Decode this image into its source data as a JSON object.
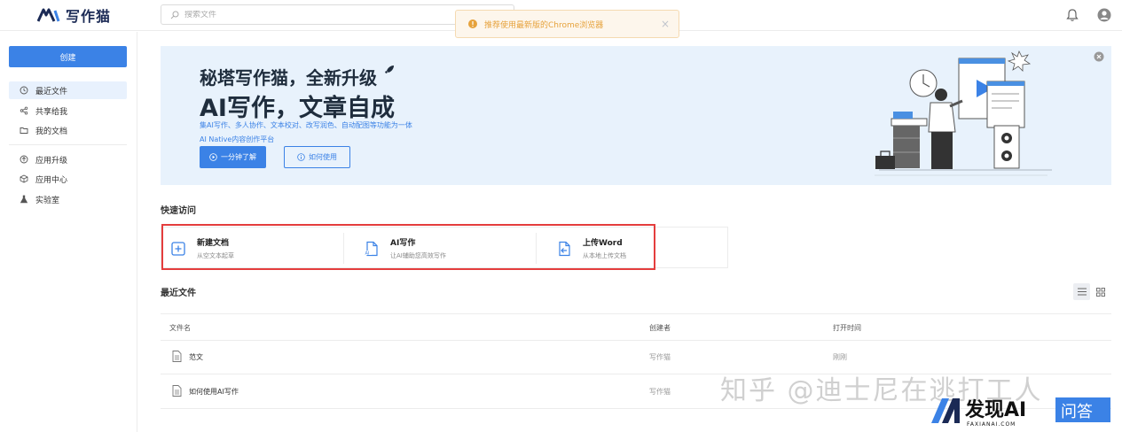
{
  "app": {
    "name": "写作猫"
  },
  "header": {
    "search_placeholder": "搜索文件",
    "toast_text": "推荐使用最新版的Chrome浏览器",
    "toast_close": "×"
  },
  "sidebar": {
    "create_label": "创建",
    "items": [
      {
        "label": "最近文件",
        "icon": "clock-icon",
        "active": true
      },
      {
        "label": "共享给我",
        "icon": "share-icon"
      },
      {
        "label": "我的文档",
        "icon": "folder-icon"
      },
      {
        "label": "应用升级",
        "icon": "upgrade-icon"
      },
      {
        "label": "应用中心",
        "icon": "cube-icon"
      },
      {
        "label": "实验室",
        "icon": "flask-icon"
      }
    ]
  },
  "banner": {
    "title1": "秘塔写作猫，全新升级",
    "title2": "AI写作，文章自成",
    "desc1": "集AI写作、多人协作、文本校对、改写润色、自动配图等功能为一体",
    "desc2": "AI Native内容创作平台",
    "btn_primary": "一分钟了解",
    "btn_secondary": "如何使用"
  },
  "quick_access": {
    "title": "快速访问",
    "cards": [
      {
        "title": "新建文档",
        "subtitle": "从空文本起草",
        "icon": "new-doc-icon"
      },
      {
        "title": "AI写作",
        "subtitle": "让AI辅助您高效写作",
        "icon": "ai-doc-icon"
      },
      {
        "title": "上传Word",
        "subtitle": "从本地上传文档",
        "icon": "upload-doc-icon"
      }
    ]
  },
  "recent": {
    "title": "最近文件",
    "columns": {
      "name": "文件名",
      "creator": "创建者",
      "opened": "打开时间"
    },
    "rows": [
      {
        "name": "范文",
        "creator": "写作猫",
        "opened": "刚刚"
      },
      {
        "name": "如何使用AI写作",
        "creator": "写作猫",
        "opened": ""
      }
    ]
  },
  "watermark": {
    "text": "知乎 @迪士尼在逃打工人",
    "logo_text": "发现AI",
    "logo_sub": "FAXIANAI.COM",
    "logo_badge": "问答"
  },
  "colors": {
    "accent": "#3b82e6",
    "highlight_box": "#e43d3d",
    "toast_text": "#e6a23c"
  }
}
